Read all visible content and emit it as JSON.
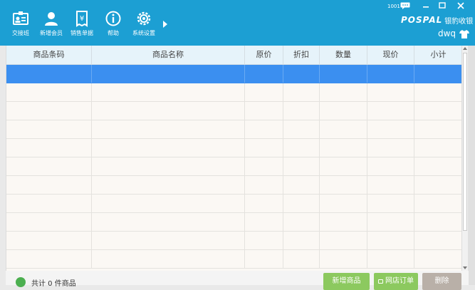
{
  "toolbar": {
    "items": [
      {
        "label": "交接班",
        "icon": "shift-handover-icon"
      },
      {
        "label": "新增会员",
        "icon": "add-member-icon"
      },
      {
        "label": "销售单据",
        "icon": "sales-receipt-icon"
      },
      {
        "label": "帮助",
        "icon": "help-icon"
      },
      {
        "label": "系统设置",
        "icon": "settings-icon"
      }
    ]
  },
  "header": {
    "terminal_id": "1001",
    "brand_logo": "POSPAL",
    "brand_cn": "银豹收银",
    "username": "dwq"
  },
  "table": {
    "columns": [
      "商品条码",
      "商品名称",
      "原价",
      "折扣",
      "数量",
      "现价",
      "小计"
    ],
    "row_count": 11,
    "selected_row": 0
  },
  "footer": {
    "summary": "共计  0  件商品",
    "new_product_button": "新增商品",
    "online_order_button": "网店订单",
    "delete_button": "删除"
  },
  "colors": {
    "header_bg": "#1c9fd3",
    "selected_row": "#3b8ff0",
    "button_green": "#8cc95f",
    "button_gray": "#b9b0a8"
  }
}
